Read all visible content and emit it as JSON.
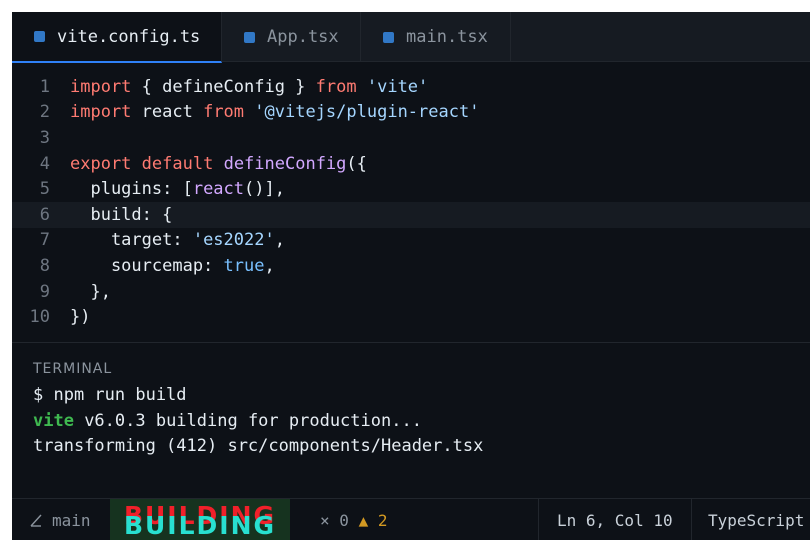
{
  "tabs": [
    {
      "label": "vite.config.ts",
      "active": true,
      "icon": "typescript-file-icon"
    },
    {
      "label": "App.tsx",
      "active": false,
      "icon": "typescript-file-icon"
    },
    {
      "label": "main.tsx",
      "active": false,
      "icon": "typescript-file-icon"
    }
  ],
  "editor": {
    "current_line": 6,
    "lines": [
      {
        "n": "1",
        "t": [
          [
            "kw",
            "import"
          ],
          [
            "pr",
            " { defineConfig } "
          ],
          [
            "kw",
            "from"
          ],
          [
            "pr",
            " "
          ],
          [
            "str",
            "'vite'"
          ]
        ]
      },
      {
        "n": "2",
        "t": [
          [
            "kw",
            "import"
          ],
          [
            "pr",
            " react "
          ],
          [
            "kw",
            "from"
          ],
          [
            "pr",
            " "
          ],
          [
            "str",
            "'@vitejs/plugin-react'"
          ]
        ]
      },
      {
        "n": "3",
        "t": []
      },
      {
        "n": "4",
        "t": [
          [
            "kw",
            "export"
          ],
          [
            "pr",
            " "
          ],
          [
            "kw",
            "default"
          ],
          [
            "pr",
            " "
          ],
          [
            "fn",
            "defineConfig"
          ],
          [
            "pr",
            "({"
          ]
        ]
      },
      {
        "n": "5",
        "t": [
          [
            "pr",
            "  plugins: ["
          ],
          [
            "fn",
            "react"
          ],
          [
            "pr",
            "()],"
          ]
        ]
      },
      {
        "n": "6",
        "t": [
          [
            "pr",
            "  build: {"
          ]
        ]
      },
      {
        "n": "7",
        "t": [
          [
            "pr",
            "    target: "
          ],
          [
            "str",
            "'es2022'"
          ],
          [
            "pr",
            ","
          ]
        ]
      },
      {
        "n": "8",
        "t": [
          [
            "pr",
            "    sourcemap: "
          ],
          [
            "cn",
            "true"
          ],
          [
            "pr",
            ","
          ]
        ]
      },
      {
        "n": "9",
        "t": [
          [
            "pr",
            "  },"
          ]
        ]
      },
      {
        "n": "10",
        "t": [
          [
            "pr",
            "})"
          ]
        ]
      }
    ]
  },
  "terminal": {
    "title": "TERMINAL",
    "command": "$ npm run build",
    "vite_label": "vite",
    "building_text": " v6.0.3 building for production...",
    "transform_line": "transforming (412) src/components/Header.tsx"
  },
  "statusbar": {
    "branch_icon": "git-branch-icon",
    "branch": "main",
    "build_status": "BUILDING",
    "errors_glyph": "×",
    "errors": "0",
    "warnings_glyph": "▲",
    "warnings": "2",
    "position": "Ln 6, Col 10",
    "language": "TypeScript"
  },
  "colors": {
    "background": "#0d1117",
    "keyword": "#ff7b72",
    "string": "#a5d6ff",
    "function": "#d2a8ff",
    "constant": "#79c0ff",
    "vite": "#3fb950",
    "accent": "#2f81f7"
  }
}
